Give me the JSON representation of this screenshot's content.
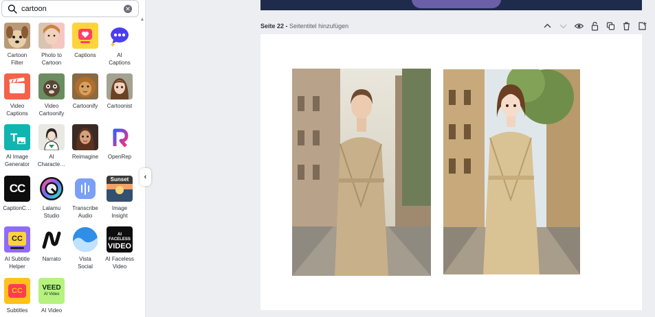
{
  "search": {
    "value": "cartoon",
    "placeholder": ""
  },
  "apps": [
    {
      "label": "Cartoon\nFilter"
    },
    {
      "label": "Photo to\nCartoon"
    },
    {
      "label": "Captions"
    },
    {
      "label": "AI\nCaptions"
    },
    {
      "label": "Video\nCaptions"
    },
    {
      "label": "Video\nCartoonify"
    },
    {
      "label": "Cartoonify"
    },
    {
      "label": "Cartoonist"
    },
    {
      "label": "AI Image\nGenerator"
    },
    {
      "label": "AI\nCharacte…"
    },
    {
      "label": "Reimagine"
    },
    {
      "label": "OpenRep"
    },
    {
      "label": "CaptionC…"
    },
    {
      "label": "Lalamu\nStudio"
    },
    {
      "label": "Transcribe\nAudio"
    },
    {
      "label": "Image\nInsight"
    },
    {
      "label": "AI Subtitle\nHelper"
    },
    {
      "label": "Narrato"
    },
    {
      "label": "Vista\nSocial"
    },
    {
      "label": "AI Faceless\nVideo"
    },
    {
      "label": "Subtitles"
    },
    {
      "label": "AI Video"
    }
  ],
  "icon_texts": {
    "cc": "CC",
    "sunset": "Sunset",
    "ai_faceless_1": "AI FACELESS",
    "ai_faceless_2": "VIDEO",
    "veed_1": "VEED",
    "veed_2": "AI Video"
  },
  "page": {
    "number_label": "Seite 22 -",
    "title_placeholder": "Seitentitel hinzufügen"
  },
  "colors": {
    "accent_purple": "#7d2ae8",
    "canvas_bg": "#eceef1"
  }
}
